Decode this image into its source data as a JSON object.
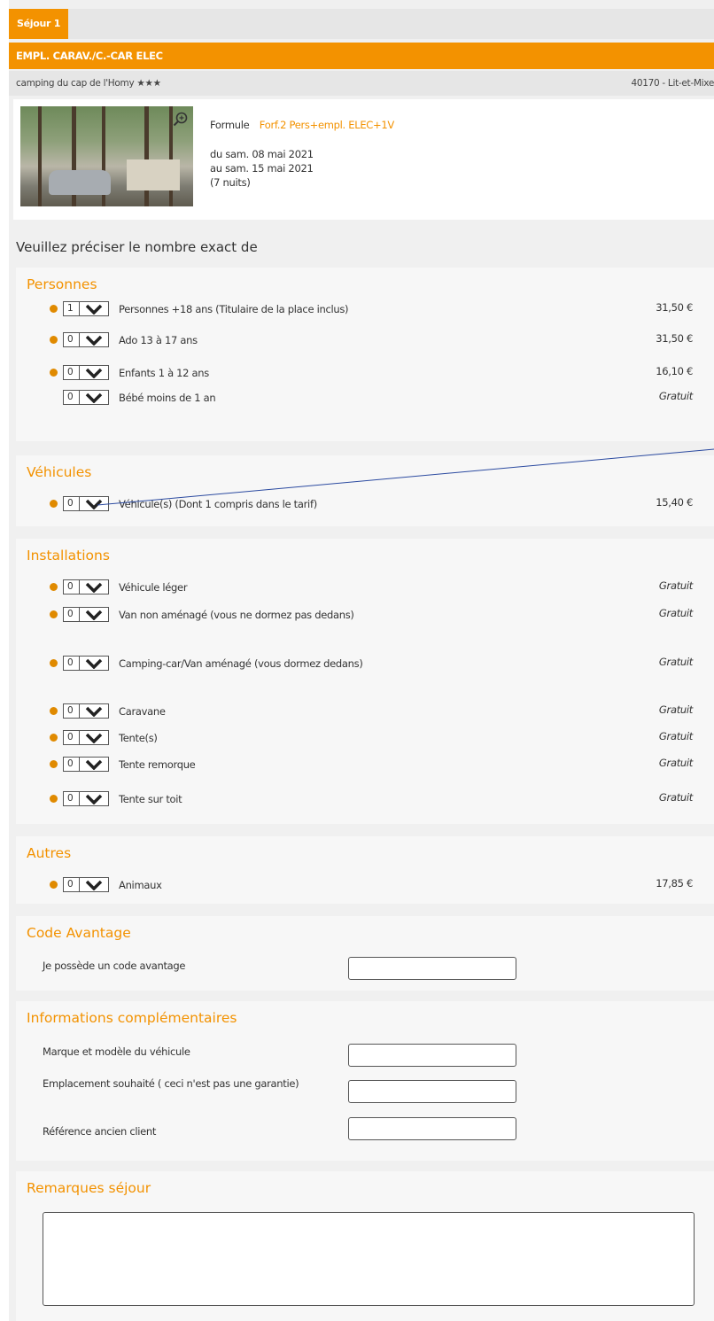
{
  "tab": {
    "label": "Séjour 1"
  },
  "header": {
    "title": "EMPL. CARAV./C.-CAR ELEC",
    "campsite": "camping du cap de l'Homy ★★★",
    "location": "40170 - Lit-et-Mixe"
  },
  "stay": {
    "formula_label": "Formule",
    "formula_value": "Forf.2 Pers+empl. ELEC+1V",
    "from": "du sam. 08 mai 2021",
    "to": "au sam. 15 mai 2021",
    "nights": "(7 nuits)"
  },
  "intro": "Veuillez préciser le nombre exact de",
  "sections": {
    "personnes": {
      "title": "Personnes",
      "rows": [
        {
          "qty": "1",
          "label": "Personnes +18 ans (Titulaire de la place inclus)",
          "price": "31,50 €"
        },
        {
          "qty": "0",
          "label": "Ado 13 à 17 ans",
          "price": "31,50 €"
        },
        {
          "qty": "0",
          "label": "Enfants 1 à 12 ans",
          "price": "16,10 €"
        },
        {
          "qty": "0",
          "label": "Bébé moins de 1 an",
          "price": "Gratuit"
        }
      ]
    },
    "vehicules": {
      "title": "Véhicules",
      "rows": [
        {
          "qty": "0",
          "label": "Véhicule(s) (Dont 1 compris dans le tarif)",
          "price": "15,40 €"
        }
      ]
    },
    "installations": {
      "title": "Installations",
      "rows": [
        {
          "qty": "0",
          "label": "Véhicule léger",
          "price": "Gratuit"
        },
        {
          "qty": "0",
          "label": "Van non aménagé (vous ne dormez pas dedans)",
          "price": "Gratuit"
        },
        {
          "qty": "0",
          "label": "Camping-car/Van aménagé (vous dormez dedans)",
          "price": "Gratuit"
        },
        {
          "qty": "0",
          "label": "Caravane",
          "price": "Gratuit"
        },
        {
          "qty": "0",
          "label": "Tente(s)",
          "price": "Gratuit"
        },
        {
          "qty": "0",
          "label": "Tente remorque",
          "price": "Gratuit"
        },
        {
          "qty": "0",
          "label": "Tente sur toit",
          "price": "Gratuit"
        }
      ]
    },
    "autres": {
      "title": "Autres",
      "rows": [
        {
          "qty": "0",
          "label": "Animaux",
          "price": "17,85 €"
        }
      ]
    },
    "code_avantage": {
      "title": "Code Avantage",
      "label": "Je possède un code avantage",
      "value": ""
    },
    "infos": {
      "title": "Informations complémentaires",
      "vehicle_label": "Marque et modèle du véhicule",
      "vehicle_value": "",
      "spot_label": "Emplacement souhaité ( ceci n'est pas une garantie)",
      "spot_value": "",
      "client_label": "Référence ancien client",
      "client_value": ""
    },
    "remarques": {
      "title": "Remarques séjour",
      "value": ""
    }
  },
  "colors": {
    "accent": "#f39200",
    "info_dot": "#e08a00",
    "panel": "#f7f7f7",
    "page": "#f0f0f0"
  }
}
